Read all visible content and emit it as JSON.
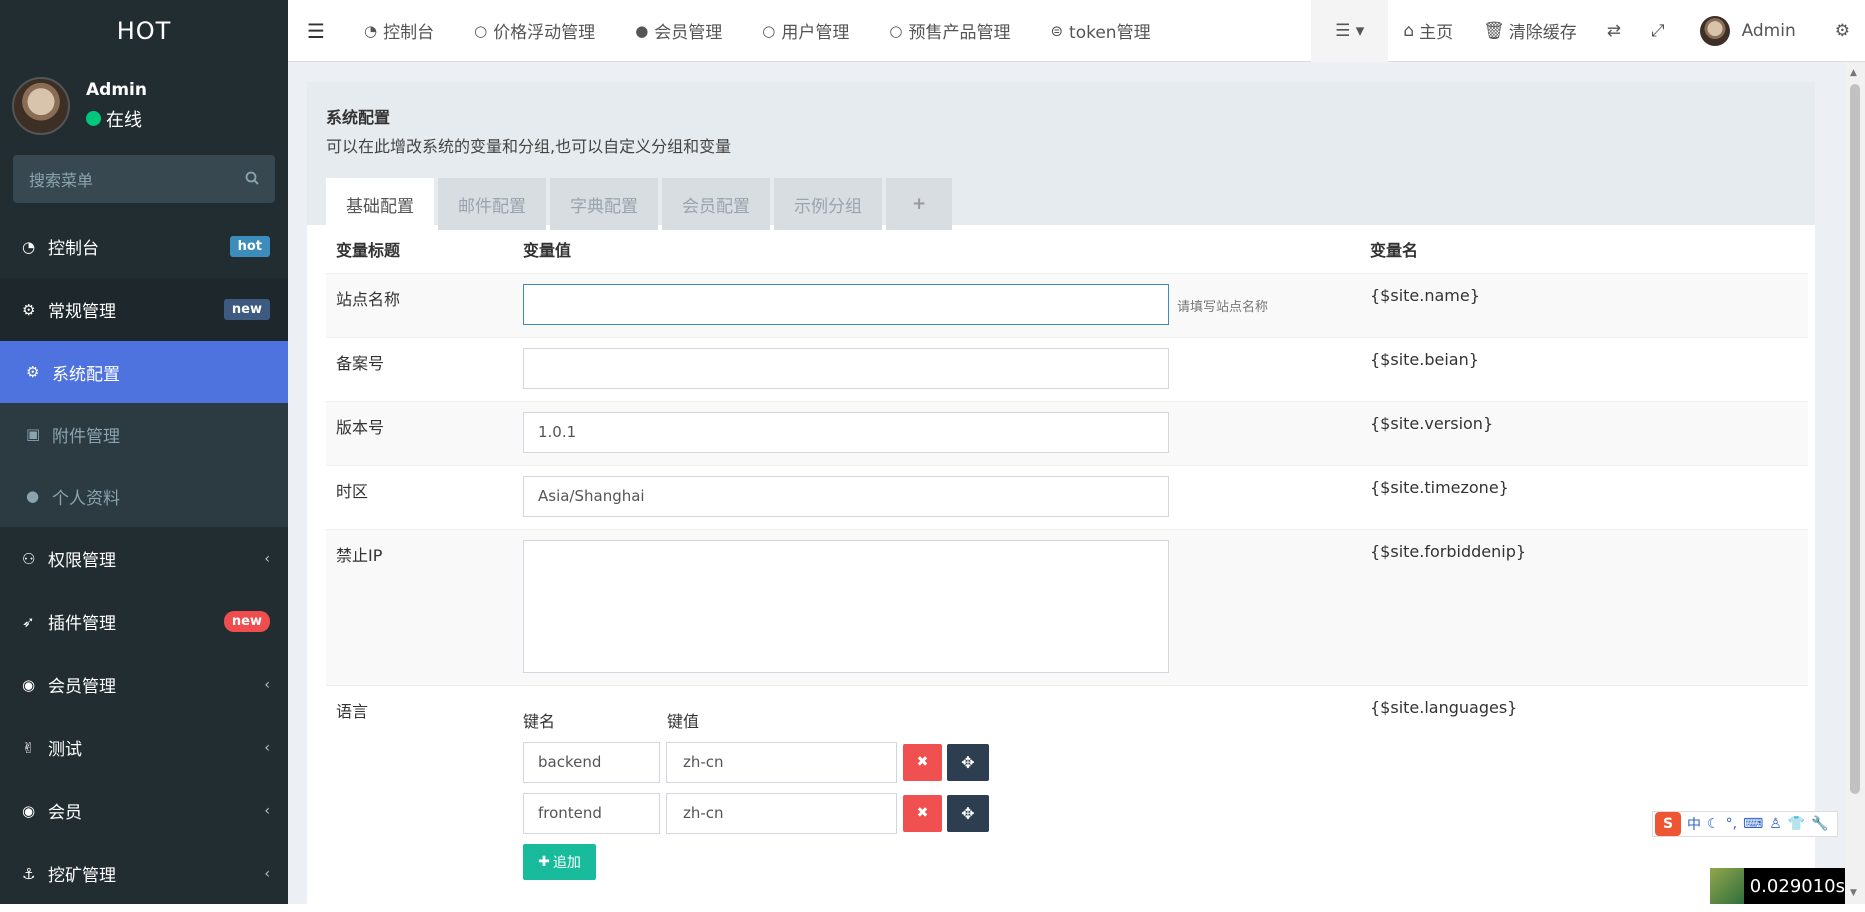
{
  "sidebar": {
    "brand": "HOT",
    "user": {
      "name": "Admin",
      "status": "在线"
    },
    "search_placeholder": "搜索菜单",
    "items": [
      {
        "label": "控制台",
        "badge": "hot"
      },
      {
        "label": "常规管理",
        "badge": "new"
      },
      {
        "label": "系统配置"
      },
      {
        "label": "附件管理"
      },
      {
        "label": "个人资料"
      },
      {
        "label": "权限管理"
      },
      {
        "label": "插件管理",
        "badge": "new"
      },
      {
        "label": "会员管理"
      },
      {
        "label": "测试"
      },
      {
        "label": "会员"
      },
      {
        "label": "挖矿管理"
      }
    ]
  },
  "topbar": {
    "links": [
      "控制台",
      "价格浮动管理",
      "会员管理",
      "用户管理",
      "预售产品管理",
      "token管理"
    ],
    "right": {
      "home": "主页",
      "clear_cache": "清除缓存",
      "user": "Admin"
    }
  },
  "page": {
    "title": "系统配置",
    "description": "可以在此增改系统的变量和分组,也可以自定义分组和变量",
    "tabs": [
      "基础配置",
      "邮件配置",
      "字典配置",
      "会员配置",
      "示例分组",
      "+"
    ]
  },
  "table": {
    "headers": {
      "title": "变量标题",
      "value": "变量值",
      "name": "变量名"
    },
    "rows": [
      {
        "title": "站点名称",
        "value": "",
        "hint": "请填写站点名称",
        "name": "{$site.name}"
      },
      {
        "title": "备案号",
        "value": "",
        "name": "{$site.beian}"
      },
      {
        "title": "版本号",
        "value": "1.0.1",
        "name": "{$site.version}"
      },
      {
        "title": "时区",
        "value": "Asia/Shanghai",
        "name": "{$site.timezone}"
      },
      {
        "title": "禁止IP",
        "value": "",
        "name": "{$site.forbiddenip}"
      },
      {
        "title": "语言",
        "name": "{$site.languages}"
      }
    ],
    "languages": {
      "key_header": "键名",
      "value_header": "键值",
      "entries": [
        {
          "key": "backend",
          "value": "zh-cn"
        },
        {
          "key": "frontend",
          "value": "zh-cn"
        }
      ],
      "add_label": "追加"
    }
  },
  "overlay": {
    "ime": {
      "mode": "中"
    },
    "perf": "0.029010s"
  }
}
